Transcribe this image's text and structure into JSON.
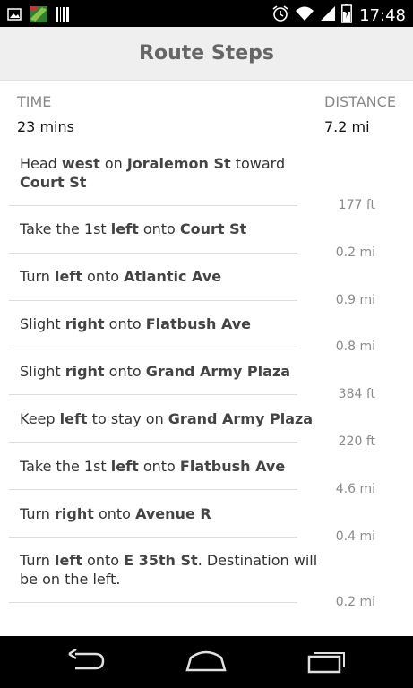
{
  "status_bar": {
    "time": "17:48"
  },
  "header": {
    "title": "Route Steps"
  },
  "summary": {
    "time_label": "TIME",
    "time_value": "23 mins",
    "distance_label": "DISTANCE",
    "distance_value": "7.2 mi"
  },
  "steps": [
    {
      "parts": [
        [
          "Head ",
          0
        ],
        [
          "west",
          1
        ],
        [
          " on ",
          0
        ],
        [
          "Joralemon St",
          1
        ],
        [
          " toward ",
          0
        ],
        [
          "Court St",
          1
        ]
      ],
      "distance": "177 ft"
    },
    {
      "parts": [
        [
          "Take the 1st ",
          0
        ],
        [
          "left",
          1
        ],
        [
          " onto ",
          0
        ],
        [
          "Court St",
          1
        ]
      ],
      "distance": "0.2 mi"
    },
    {
      "parts": [
        [
          "Turn ",
          0
        ],
        [
          "left",
          1
        ],
        [
          " onto ",
          0
        ],
        [
          "Atlantic Ave",
          1
        ]
      ],
      "distance": "0.9 mi"
    },
    {
      "parts": [
        [
          "Slight ",
          0
        ],
        [
          "right",
          1
        ],
        [
          " onto ",
          0
        ],
        [
          "Flatbush Ave",
          1
        ]
      ],
      "distance": "0.8 mi"
    },
    {
      "parts": [
        [
          "Slight ",
          0
        ],
        [
          "right",
          1
        ],
        [
          " onto ",
          0
        ],
        [
          "Grand Army Plaza",
          1
        ]
      ],
      "distance": "384 ft"
    },
    {
      "parts": [
        [
          "Keep ",
          0
        ],
        [
          "left",
          1
        ],
        [
          " to stay on ",
          0
        ],
        [
          "Grand Army Plaza",
          1
        ]
      ],
      "distance": "220 ft"
    },
    {
      "parts": [
        [
          "Take the 1st ",
          0
        ],
        [
          "left",
          1
        ],
        [
          " onto ",
          0
        ],
        [
          "Flatbush Ave",
          1
        ]
      ],
      "distance": "4.6 mi"
    },
    {
      "parts": [
        [
          "Turn ",
          0
        ],
        [
          "right",
          1
        ],
        [
          " onto ",
          0
        ],
        [
          "Avenue R",
          1
        ]
      ],
      "distance": "0.4 mi"
    },
    {
      "parts": [
        [
          "Turn ",
          0
        ],
        [
          "left",
          1
        ],
        [
          " onto ",
          0
        ],
        [
          "E 35th St",
          1
        ],
        [
          ". Destination will be on the left.",
          0
        ]
      ],
      "distance": "0.2 mi"
    }
  ],
  "icons": {
    "status_left": [
      "image-icon",
      "app-notification-icon",
      "barcode-icon"
    ],
    "status_right": [
      "alarm-icon",
      "wifi-icon",
      "signal-icon",
      "battery-charging-icon"
    ],
    "nav": [
      "back-icon",
      "home-icon",
      "recents-icon"
    ]
  },
  "colors": {
    "header_bg": "#efefef",
    "title": "#666666",
    "label": "#8a8a8a",
    "separator": "#dddddd"
  }
}
